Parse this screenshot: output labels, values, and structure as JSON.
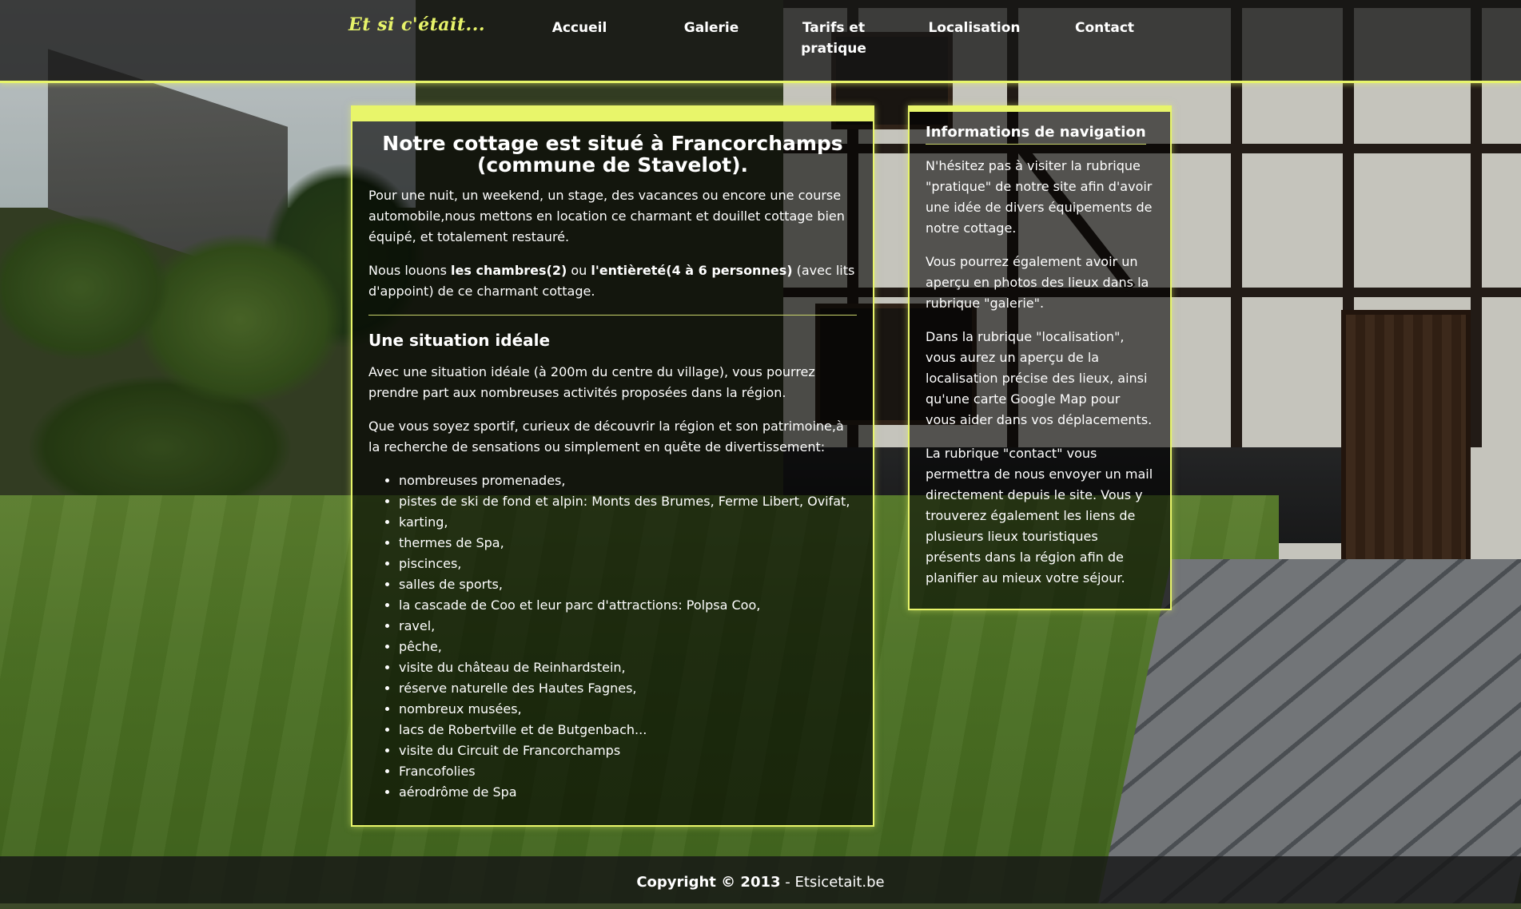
{
  "site": {
    "logo": "Et si c'était...",
    "nav": [
      {
        "label": "Accueil"
      },
      {
        "label": "Galerie"
      },
      {
        "label": "Tarifs et pratique"
      },
      {
        "label": "Localisation"
      },
      {
        "label": "Contact"
      }
    ]
  },
  "main": {
    "title": "Notre cottage est situé à Francorchamps (commune de Stavelot).",
    "intro": "Pour une nuit, un weekend, un stage, des vacances ou encore une course automobile,nous mettons en location ce charmant et douillet cottage bien équipé, et totalement restauré.",
    "rent_prefix": "Nous louons ",
    "rent_rooms": "les chambres(2)",
    "rent_or": " ou ",
    "rent_whole": "l'entièreté(4 à 6 personnes)",
    "rent_suffix": " (avec lits d'appoint) de ce charmant cottage.",
    "section_title": "Une situation idéale",
    "situation": "Avec une situation idéale (à 200m du centre du village), vous pourrez prendre part aux nombreuses activités proposées dans la région.",
    "visitors": "Que vous soyez sportif, curieux de découvrir la région et son patrimoine,à la recherche de sensations ou simplement en quête de divertissement:",
    "activities": [
      "nombreuses promenades,",
      "pistes de ski de fond et alpin: Monts des Brumes, Ferme Libert, Ovifat,",
      "karting,",
      "thermes de Spa,",
      "piscinces,",
      "salles de sports,",
      "la cascade de Coo et leur parc d'attractions: Polpsa Coo,",
      "ravel,",
      "pêche,",
      "visite du château de Reinhardstein,",
      "réserve naturelle des Hautes Fagnes,",
      "nombreux musées,",
      "lacs de Robertville et de Butgenbach...",
      "visite du Circuit de Francorchamps",
      "Francofolies",
      "aérodrôme de Spa"
    ]
  },
  "side": {
    "title": "Informations de navigation",
    "paragraphs": [
      "N'hésitez pas à visiter la rubrique \"pratique\" de notre site afin d'avoir une idée de divers équipements de notre cottage.",
      "Vous pourrez également avoir un aperçu en photos des lieux dans la rubrique \"galerie\".",
      "Dans la rubrique \"localisation\", vous aurez un aperçu de la localisation précise des lieux, ainsi qu'une carte Google Map pour vous aider dans vos déplacements.",
      "La rubrique \"contact\" vous permettra de nous envoyer un mail directement depuis le site. Vous y trouverez également les liens de plusieurs lieux touristiques présents dans la région afin de planifier au mieux votre séjour."
    ]
  },
  "footer": {
    "copyright": "Copyright © 2013",
    "separator": " - ",
    "site": "Etsicetait.be"
  },
  "colors": {
    "accent": "#e8f56a",
    "logo": "#e7f36a",
    "panel": "rgba(0,0,0,0.6)",
    "header": "#161616"
  }
}
